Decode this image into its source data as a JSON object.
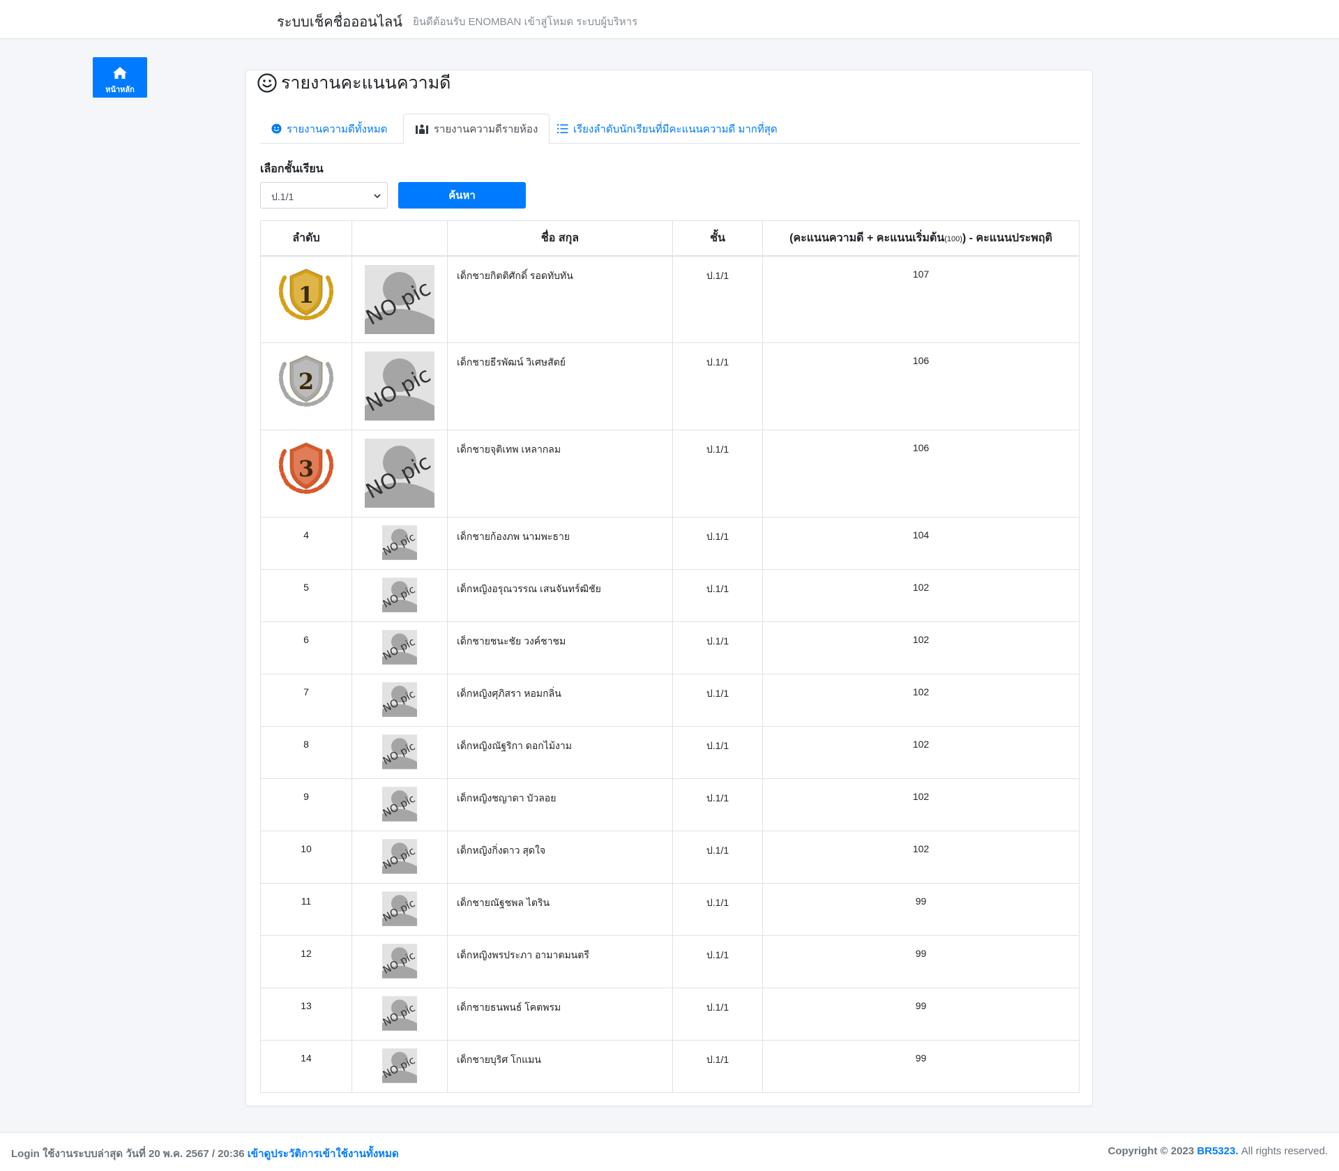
{
  "header": {
    "brand": "ระบบเช็คชื่อออนไลน์",
    "welcome": "ยินดีต้อนรับ ENOMBAN เข้าสู่โหมด ระบบผู้บริหาร"
  },
  "sidebar": {
    "home_label": "หน้าหลัก"
  },
  "page": {
    "title": "รายงานคะแนนความดี"
  },
  "tabs": [
    {
      "label": "รายงานความดีทั้งหมด",
      "icon": "smile-icon",
      "active": false
    },
    {
      "label": "รายงานความดีรายห้อง",
      "icon": "classroom-icon",
      "active": true
    },
    {
      "label": "เรียงลำดับนักเรียนที่มีคะแนนความดี มากที่สุด",
      "icon": "list-ol-icon",
      "active": false
    }
  ],
  "filter": {
    "label": "เลือกชั้นเรียน",
    "selected_class": "ป.1/1",
    "search_label": "ค้นหา"
  },
  "table": {
    "headers": {
      "rank": "ลำดับ",
      "name": "ชื่อ สกุล",
      "class": "ชั้น",
      "score_main": "(คะแนนความดี + คะแนนเริ่มต้น",
      "score_sub": "(100)",
      "score_tail": ") - คะแนนประพฤติ"
    },
    "rows": [
      {
        "rank": "1",
        "name": "เด็กชายกิตติศักดิ์ รอดทับทัน",
        "class": "ป.1/1",
        "score": "107"
      },
      {
        "rank": "2",
        "name": "เด็กชายธีรพัฒน์ วิเศษสัตย์",
        "class": "ป.1/1",
        "score": "106"
      },
      {
        "rank": "3",
        "name": "เด็กชายจุติเทพ เหลากลม",
        "class": "ป.1/1",
        "score": "106"
      },
      {
        "rank": "4",
        "name": "เด็กชายก้องภพ นามพะธาย",
        "class": "ป.1/1",
        "score": "104"
      },
      {
        "rank": "5",
        "name": "เด็กหญิงอรุณวรรณ เสนจันทร์ฒิชัย",
        "class": "ป.1/1",
        "score": "102"
      },
      {
        "rank": "6",
        "name": "เด็กชายชนะชัย วงค์ชาชม",
        "class": "ป.1/1",
        "score": "102"
      },
      {
        "rank": "7",
        "name": "เด็กหญิงศุภิสรา หอมกลิ่น",
        "class": "ป.1/1",
        "score": "102"
      },
      {
        "rank": "8",
        "name": "เด็กหญิงณัฐริกา ดอกไม้งาม",
        "class": "ป.1/1",
        "score": "102"
      },
      {
        "rank": "9",
        "name": "เด็กหญิงชญาดา บัวลอย",
        "class": "ป.1/1",
        "score": "102"
      },
      {
        "rank": "10",
        "name": "เด็กหญิงกิ่งดาว สุดใจ",
        "class": "ป.1/1",
        "score": "102"
      },
      {
        "rank": "11",
        "name": "เด็กชายณัฐชพล ไตริน",
        "class": "ป.1/1",
        "score": "99"
      },
      {
        "rank": "12",
        "name": "เด็กหญิงพรประภา อามาตมนตรี",
        "class": "ป.1/1",
        "score": "99"
      },
      {
        "rank": "13",
        "name": "เด็กชายธนพนธ์ โคตพรม",
        "class": "ป.1/1",
        "score": "99"
      },
      {
        "rank": "14",
        "name": "เด็กชายบุริศ โกแมน",
        "class": "ป.1/1",
        "score": "99"
      }
    ],
    "photo_placeholder_text": "NO pic"
  },
  "footer": {
    "last_login": "Login ใช้งานระบบล่าสุด วันที่ 20 พ.ค. 2567 / 20:36",
    "history_link": "เข้าดูประวัติการเข้าใช้งานทั้งหมด",
    "copyright_prefix": "Copyright © 2023",
    "copyright_owner": "BR5323.",
    "copyright_suffix": "All rights reserved."
  },
  "colors": {
    "primary": "#007bff",
    "gold": "#d4a017",
    "silver": "#a8a8a8",
    "bronze": "#d9582b"
  }
}
